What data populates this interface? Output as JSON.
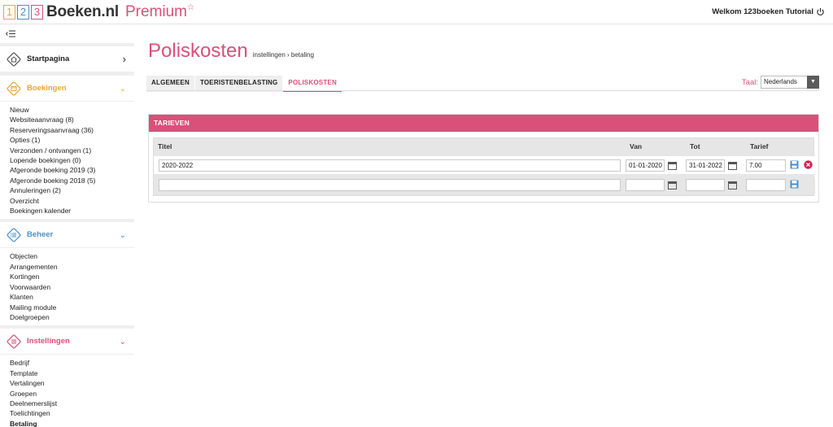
{
  "header": {
    "logo_digits": [
      "1",
      "2",
      "3"
    ],
    "brand": "Boeken.nl",
    "premium": "Premium",
    "star": "☆",
    "welcome": "Welkom 123boeken Tutorial"
  },
  "sidebar": {
    "startpagina": "Startpagina",
    "boekingen": {
      "title": "Boekingen",
      "items": [
        "Nieuw",
        "Websiteaanvraag (8)",
        "Reserveringsaanvraag (36)",
        "Opties (1)",
        "Verzonden / ontvangen (1)",
        "Lopende boekingen (0)",
        "Afgeronde boeking 2019 (3)",
        "Afgeronde boeking 2018 (5)",
        "Annuleringen (2)",
        "Overzicht",
        "Boekingen kalender"
      ]
    },
    "beheer": {
      "title": "Beheer",
      "items": [
        "Objecten",
        "Arrangementen",
        "Kortingen",
        "Voorwaarden",
        "Klanten",
        "Mailing module",
        "Doelgroepen"
      ]
    },
    "instellingen": {
      "title": "Instellingen",
      "items": [
        "Bedrijf",
        "Template",
        "Vertalingen",
        "Groepen",
        "Deelnemerslijst",
        "Toelichtingen",
        "Betaling"
      ]
    }
  },
  "main": {
    "title": "Poliskosten",
    "breadcrumb": "instellingen › betaling",
    "tabs": [
      "ALGEMEEN",
      "TOERISTENBELASTING",
      "POLISKOSTEN"
    ],
    "taal_label": "Taal:",
    "taal_value": "Nederlands",
    "section_title": "TARIEVEN",
    "columns": [
      "Titel",
      "Van",
      "Tot",
      "Tarief"
    ],
    "rows": [
      {
        "titel": "2020-2022",
        "van": "01-01-2020",
        "tot": "31-01-2022",
        "tarief": "7.00"
      },
      {
        "titel": "",
        "van": "",
        "tot": "",
        "tarief": ""
      }
    ]
  },
  "colors": {
    "accent_pink": "#d9507a",
    "orange": "#e9a53c",
    "blue": "#4a90c8"
  }
}
